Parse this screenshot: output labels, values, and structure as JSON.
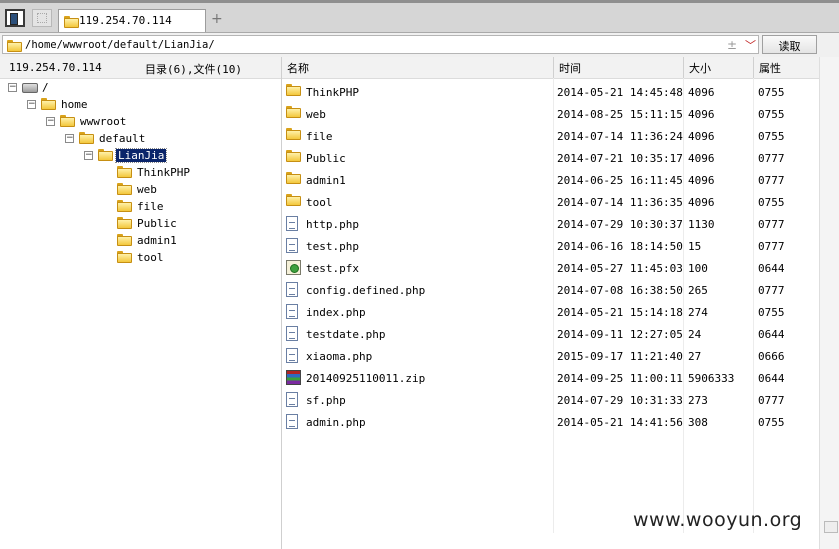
{
  "tab": {
    "title": "119.254.70.114",
    "add": "+"
  },
  "address": {
    "path": "/home/wwwroot/default/LianJia/",
    "plus": "±",
    "chevron": "﹀",
    "read_button": "读取"
  },
  "left_header": {
    "host": "119.254.70.114",
    "summary": "目录(6),文件(10)"
  },
  "tree": [
    {
      "label": "/",
      "icon": "drive-icon",
      "expander": "−"
    },
    {
      "label": "home",
      "icon": "folder-icon",
      "expander": "−"
    },
    {
      "label": "wwwroot",
      "icon": "folder-icon",
      "expander": "−"
    },
    {
      "label": "default",
      "icon": "folder-icon",
      "expander": "−"
    },
    {
      "label": "LianJia",
      "icon": "folder-icon",
      "expander": "−",
      "selected": true
    },
    {
      "label": "ThinkPHP",
      "icon": "folder-icon"
    },
    {
      "label": "web",
      "icon": "folder-icon"
    },
    {
      "label": "file",
      "icon": "folder-icon"
    },
    {
      "label": "Public",
      "icon": "folder-icon"
    },
    {
      "label": "admin1",
      "icon": "folder-icon"
    },
    {
      "label": "tool",
      "icon": "folder-icon"
    }
  ],
  "columns": {
    "name": "名称",
    "time": "时间",
    "size": "大小",
    "attr": "属性"
  },
  "files": [
    {
      "name": "ThinkPHP",
      "time": "2014-05-21 14:45:48",
      "size": "4096",
      "attr": "0755",
      "icon": "folder-icon"
    },
    {
      "name": "web",
      "time": "2014-08-25 15:11:15",
      "size": "4096",
      "attr": "0755",
      "icon": "folder-icon"
    },
    {
      "name": "file",
      "time": "2014-07-14 11:36:24",
      "size": "4096",
      "attr": "0755",
      "icon": "folder-icon"
    },
    {
      "name": "Public",
      "time": "2014-07-21 10:35:17",
      "size": "4096",
      "attr": "0777",
      "icon": "folder-icon"
    },
    {
      "name": "admin1",
      "time": "2014-06-25 16:11:45",
      "size": "4096",
      "attr": "0777",
      "icon": "folder-icon"
    },
    {
      "name": "tool",
      "time": "2014-07-14 11:36:35",
      "size": "4096",
      "attr": "0755",
      "icon": "folder-icon"
    },
    {
      "name": "http.php",
      "time": "2014-07-29 10:30:37",
      "size": "1130",
      "attr": "0777",
      "icon": "file-icon"
    },
    {
      "name": "test.php",
      "time": "2014-06-16 18:14:50",
      "size": "15",
      "attr": "0777",
      "icon": "file-icon"
    },
    {
      "name": "test.pfx",
      "time": "2014-05-27 11:45:03",
      "size": "100",
      "attr": "0644",
      "icon": "certificate-icon"
    },
    {
      "name": "config.defined.php",
      "time": "2014-07-08 16:38:50",
      "size": "265",
      "attr": "0777",
      "icon": "file-icon"
    },
    {
      "name": "index.php",
      "time": "2014-05-21 15:14:18",
      "size": "274",
      "attr": "0755",
      "icon": "file-icon"
    },
    {
      "name": "testdate.php",
      "time": "2014-09-11 12:27:05",
      "size": "24",
      "attr": "0644",
      "icon": "file-icon"
    },
    {
      "name": "xiaoma.php",
      "time": "2015-09-17 11:21:40",
      "size": "27",
      "attr": "0666",
      "icon": "file-icon"
    },
    {
      "name": "20140925110011.zip",
      "time": "2014-09-25 11:00:11",
      "size": "5906333",
      "attr": "0644",
      "icon": "archive-icon"
    },
    {
      "name": "sf.php",
      "time": "2014-07-29 10:31:33",
      "size": "273",
      "attr": "0777",
      "icon": "file-icon"
    },
    {
      "name": "admin.php",
      "time": "2014-05-21 14:41:56",
      "size": "308",
      "attr": "0755",
      "icon": "file-icon"
    }
  ],
  "watermark": "www.wooyun.org"
}
